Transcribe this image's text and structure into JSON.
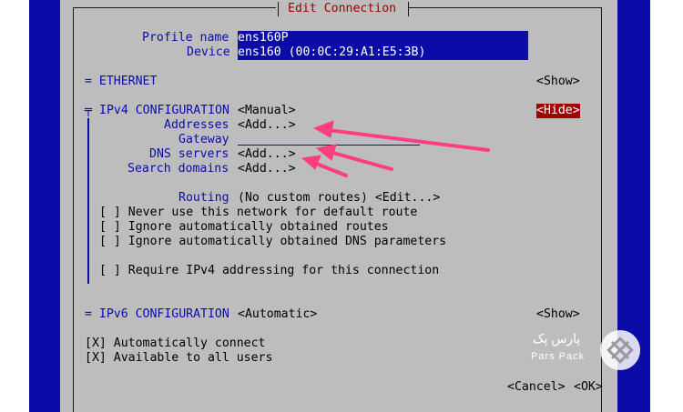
{
  "dialog": {
    "title": "Edit Connection"
  },
  "profile": {
    "name_label": "Profile name",
    "name_value": "ens160P",
    "device_label": "Device",
    "device_value": "ens160 (00:0C:29:A1:E5:3B)"
  },
  "ethernet": {
    "label": "= ETHERNET",
    "toggle": "<Show>"
  },
  "ipv4": {
    "marker": "╤",
    "label": "IPv4 CONFIGURATION",
    "mode": "<Manual>",
    "toggle": "<Hide>",
    "addresses_label": "Addresses",
    "addresses_value": "<Add...>",
    "gateway_label": "Gateway",
    "gateway_value": "",
    "dns_label": "DNS servers",
    "dns_value": "<Add...>",
    "search_label": "Search domains",
    "search_value": "<Add...>",
    "routing_label": "Routing",
    "routing_value": "(No custom routes) <Edit...>",
    "checkboxes": [
      "[ ] Never use this network for default route",
      "[ ] Ignore automatically obtained routes",
      "[ ] Ignore automatically obtained DNS parameters",
      "[ ] Require IPv4 addressing for this connection"
    ]
  },
  "ipv6": {
    "label": "= IPv6 CONFIGURATION",
    "mode": "<Automatic>",
    "toggle": "<Show>"
  },
  "general": {
    "auto_connect": "[X] Automatically connect",
    "all_users": "[X] Available to all users"
  },
  "buttons": {
    "cancel": "<Cancel>",
    "ok": "<OK>"
  },
  "watermark": {
    "brand_fa": "پارس پک",
    "brand_en": "Pars Pack"
  },
  "colors": {
    "tui_blue": "#0b0ca8",
    "dialog_gray": "#bdbdbd",
    "accent_red": "#a10000",
    "arrow_pink": "#ff3d7f"
  }
}
